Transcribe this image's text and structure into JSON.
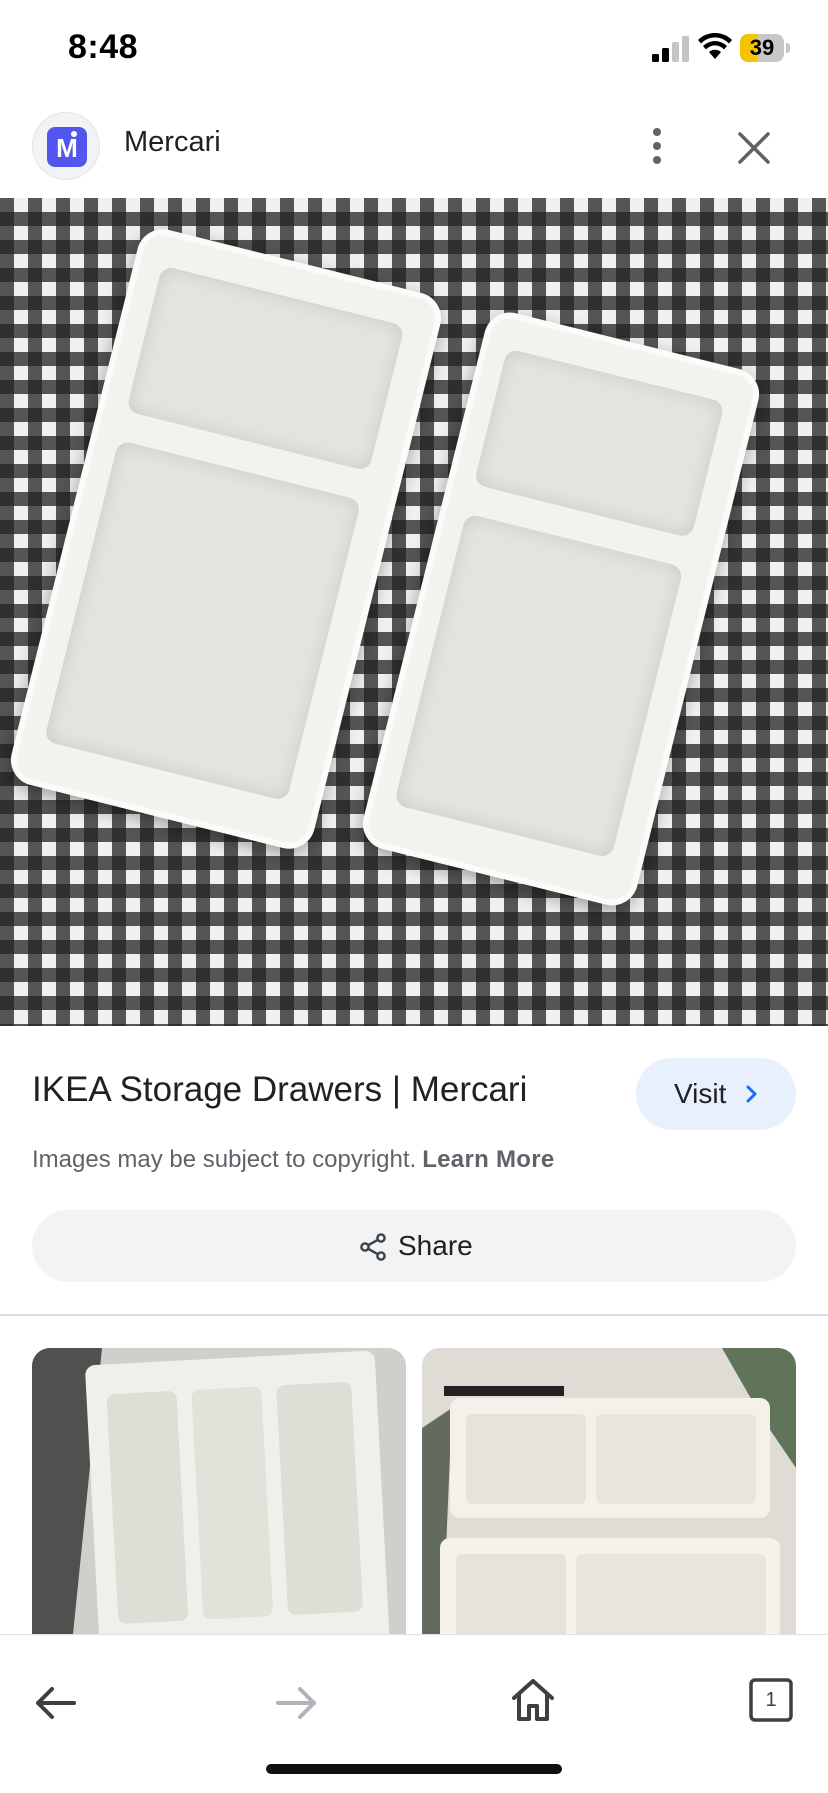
{
  "status_bar": {
    "time": "8:48",
    "battery_percent": "39",
    "battery_level": 0.39,
    "battery_color": "#f5c400"
  },
  "header": {
    "site_name": "Mercari",
    "logo_letter": "M",
    "logo_color": "#5356ee",
    "more_icon": "more-vert-icon",
    "close_icon": "close-icon"
  },
  "result": {
    "title": "IKEA Storage Drawers | Mercari",
    "visit_label": "Visit",
    "copyright_text": "Images may be subject to copyright.",
    "learn_more_label": "Learn More",
    "share_label": "Share"
  },
  "bottom_nav": {
    "back_icon": "arrow-back-icon",
    "forward_icon": "arrow-forward-icon",
    "home_icon": "home-icon",
    "tab_count": "1"
  }
}
